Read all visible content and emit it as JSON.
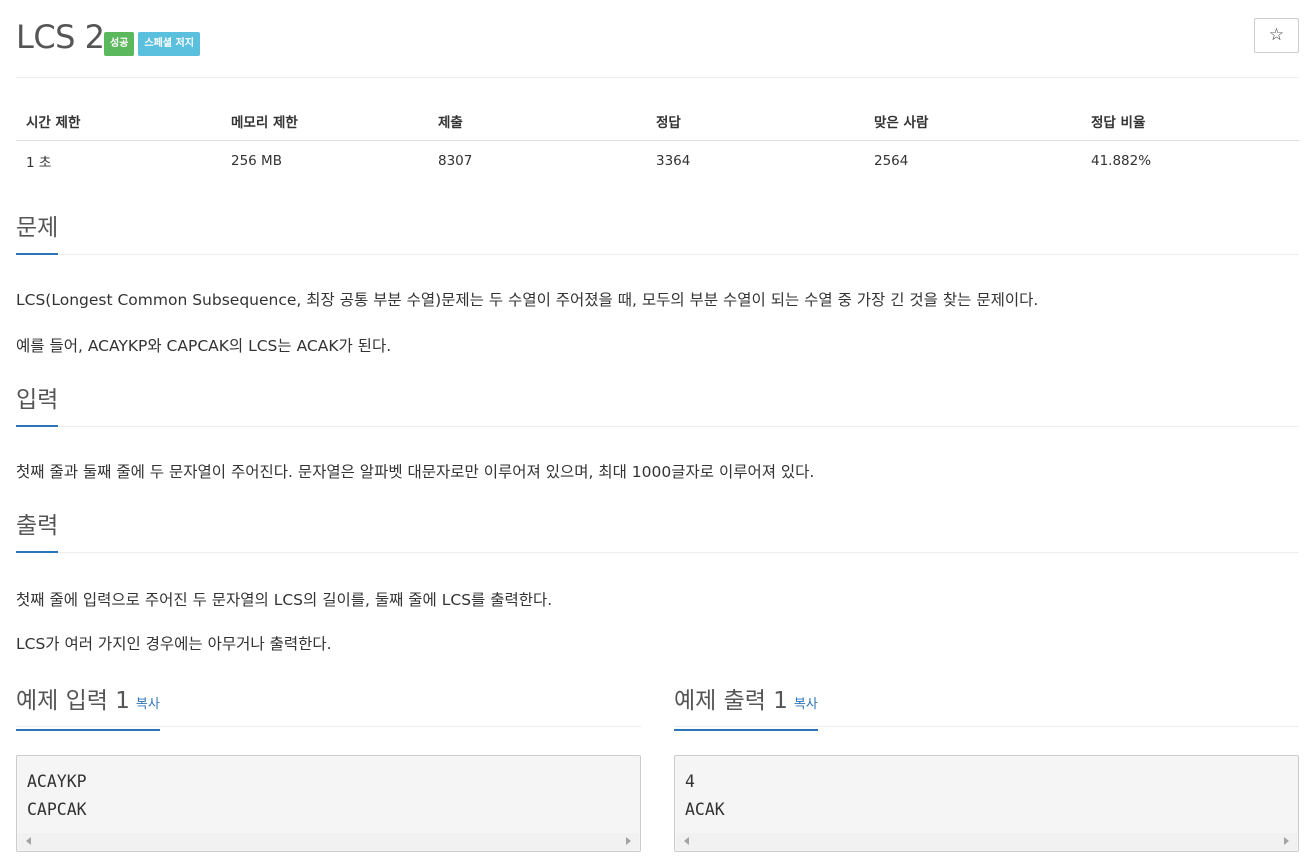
{
  "problem": {
    "title": "LCS 2",
    "badges": [
      "성공",
      "스페셜 저지"
    ],
    "star_icon": "☆"
  },
  "info_table": {
    "headers": [
      "시간 제한",
      "메모리 제한",
      "제출",
      "정답",
      "맞은 사람",
      "정답 비율"
    ],
    "values": [
      "1 초",
      "256 MB",
      "8307",
      "3364",
      "2564",
      "41.882%"
    ]
  },
  "sections": {
    "problem": {
      "title": "문제",
      "paragraphs": [
        "LCS(Longest Common Subsequence, 최장 공통 부분 수열)문제는 두 수열이 주어졌을 때, 모두의 부분 수열이 되는 수열 중 가장 긴 것을 찾는 문제이다.",
        "예를 들어, ACAYKP와 CAPCAK의 LCS는 ACAK가 된다."
      ]
    },
    "input": {
      "title": "입력",
      "paragraphs": [
        "첫째 줄과 둘째 줄에 두 문자열이 주어진다. 문자열은 알파벳 대문자로만 이루어져 있으며, 최대 1000글자로 이루어져 있다."
      ]
    },
    "output": {
      "title": "출력",
      "paragraphs": [
        "첫째 줄에 입력으로 주어진 두 문자열의 LCS의 길이를, 둘째 줄에 LCS를 출력한다.",
        "LCS가 여러 가지인 경우에는 아무거나 출력한다."
      ]
    }
  },
  "examples": {
    "input": {
      "title": "예제 입력 1",
      "copy_label": "복사",
      "content": "ACAYKP\nCAPCAK"
    },
    "output": {
      "title": "예제 출력 1",
      "copy_label": "복사",
      "content": "4\nACAK"
    }
  },
  "colors": {
    "success_badge": "#5cb85c",
    "special_badge": "#5bc0de",
    "accent": "#2e74b8"
  }
}
